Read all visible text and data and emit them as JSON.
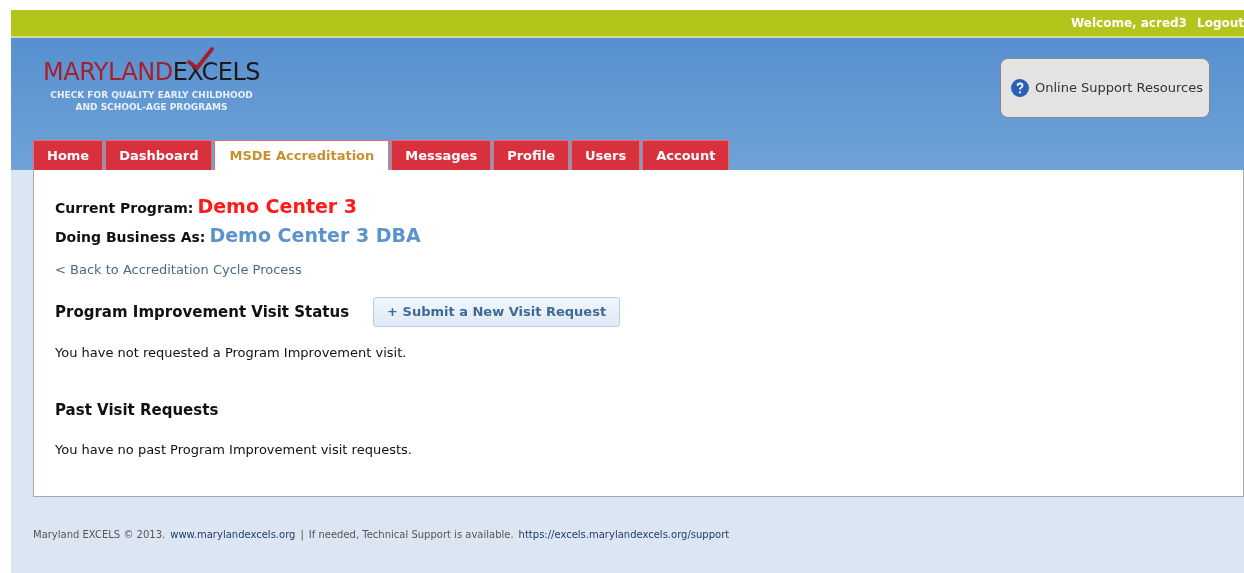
{
  "top_bar": {
    "welcome": "Welcome, acred3",
    "logout": "Logout"
  },
  "logo": {
    "part_1": "MARYLAND",
    "part_2": "EXCELS",
    "tagline": [
      "CHECK FOR QUALITY EARLY CHILDHOOD",
      "AND SCHOOL-AGE PROGRAMS"
    ]
  },
  "support_button": {
    "label": "Online Support Resources"
  },
  "tabs": [
    {
      "label": "Home",
      "selected": false
    },
    {
      "label": "Dashboard",
      "selected": false
    },
    {
      "label": "MSDE Accreditation",
      "selected": true
    },
    {
      "label": "Messages",
      "selected": false
    },
    {
      "label": "Profile",
      "selected": false
    },
    {
      "label": "Users",
      "selected": false
    },
    {
      "label": "Account",
      "selected": false
    }
  ],
  "program": {
    "current_label": "Current Program:",
    "current_value": "Demo Center 3",
    "dba_label": "Doing Business As:",
    "dba_value": "Demo Center 3 DBA"
  },
  "back_link": "< Back to Accreditation Cycle Process",
  "status_section": {
    "heading": "Program Improvement Visit Status",
    "button": "+ Submit a New Visit Request",
    "message": "You have not requested a Program Improvement visit."
  },
  "past_section": {
    "heading": "Past Visit Requests",
    "message": "You have no past Program Improvement visit requests."
  },
  "footer": [
    {
      "kind": "text",
      "text": "Maryland EXCELS © 2013."
    },
    {
      "kind": "link",
      "text": "www.marylandexcels.org"
    },
    {
      "kind": "text",
      "text": "|"
    },
    {
      "kind": "text",
      "text": "If needed, Technical Support is available."
    },
    {
      "kind": "link",
      "text": "https://excels.marylandexcels.org/support"
    }
  ]
}
